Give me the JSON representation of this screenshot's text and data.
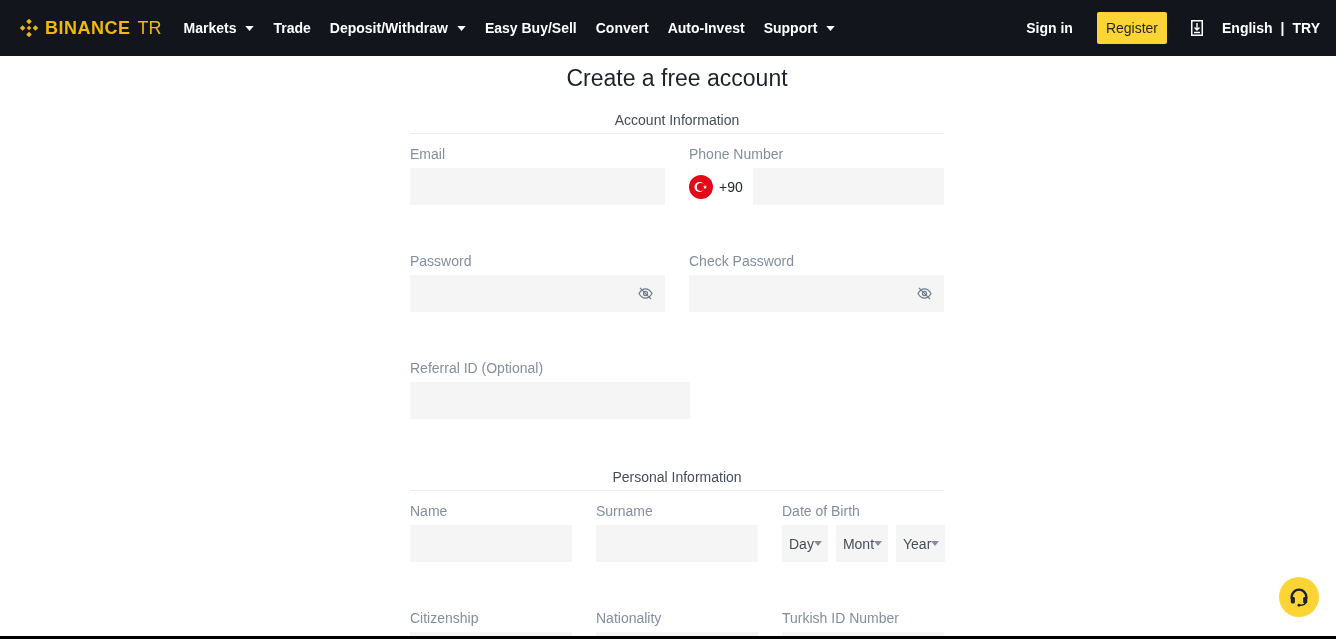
{
  "nav": {
    "logo_text": "BINANCE",
    "logo_suffix": "TR",
    "items": [
      {
        "label": "Markets",
        "has_dropdown": true
      },
      {
        "label": "Trade",
        "has_dropdown": false
      },
      {
        "label": "Deposit/Withdraw",
        "has_dropdown": true
      },
      {
        "label": "Easy Buy/Sell",
        "has_dropdown": false
      },
      {
        "label": "Convert",
        "has_dropdown": false
      },
      {
        "label": "Auto-Invest",
        "has_dropdown": false
      },
      {
        "label": "Support",
        "has_dropdown": true
      }
    ],
    "sign_in": "Sign in",
    "register": "Register",
    "language": "English",
    "separator": "|",
    "currency": "TRY"
  },
  "title": "Create a free account",
  "sections": [
    {
      "heading": "Account Information",
      "rows": [
        {
          "kind": "pair",
          "fields": [
            {
              "kind": "text",
              "label": "Email"
            },
            {
              "kind": "phone",
              "label": "Phone Number",
              "code": "+90"
            }
          ]
        },
        {
          "kind": "pair",
          "fields": [
            {
              "kind": "password",
              "label": "Password"
            },
            {
              "kind": "password",
              "label": "Check Password"
            }
          ]
        },
        {
          "kind": "pair",
          "fields": [
            {
              "kind": "text",
              "label": "Referral ID (Optional)",
              "wide": true
            }
          ]
        }
      ]
    },
    {
      "heading": "Personal Information",
      "rows": [
        {
          "kind": "triple",
          "fields": [
            {
              "kind": "text",
              "label": "Name"
            },
            {
              "kind": "text",
              "label": "Surname"
            },
            {
              "kind": "date",
              "label": "Date of Birth",
              "parts": [
                "Day",
                "Mont",
                "Year"
              ]
            }
          ]
        },
        {
          "kind": "triple",
          "fields": [
            {
              "kind": "text",
              "label": "Citizenship"
            },
            {
              "kind": "text",
              "label": "Nationality"
            },
            {
              "kind": "text",
              "label": "Turkish ID Number"
            }
          ]
        }
      ]
    }
  ]
}
